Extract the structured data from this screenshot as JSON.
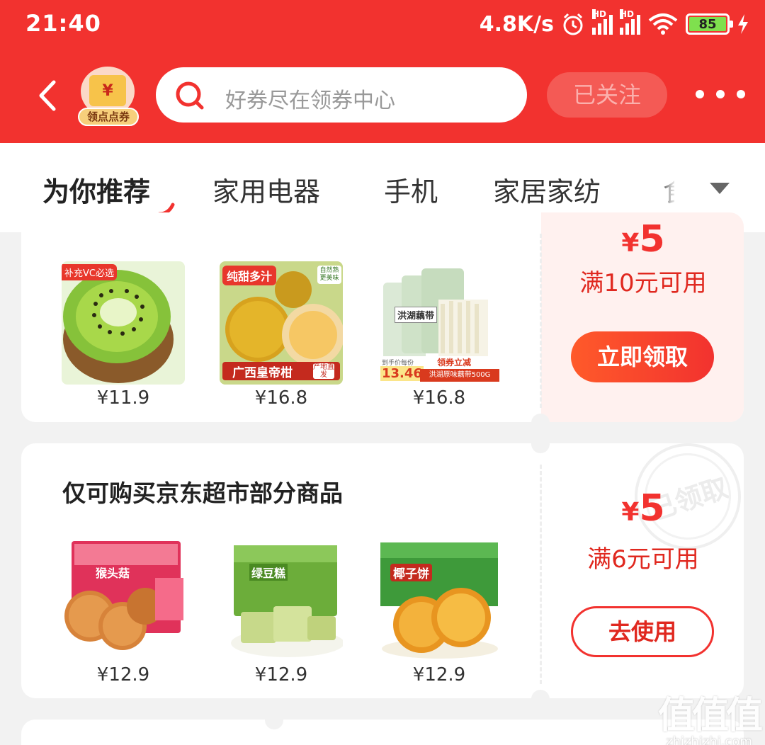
{
  "status": {
    "time": "21:40",
    "speed": "4.8K/s",
    "hd1": "HD",
    "hd2": "HD",
    "battery": "85"
  },
  "header": {
    "badge_symbol": "¥",
    "badge_label": "领点点券",
    "search_placeholder": "好券尽在领券中心",
    "follow_label": "已关注"
  },
  "tabs": [
    {
      "label": "为你推荐",
      "active": true
    },
    {
      "label": "家用电器"
    },
    {
      "label": "手机"
    },
    {
      "label": "家居家纺"
    },
    {
      "label": "食"
    }
  ],
  "coupons": [
    {
      "title": "",
      "symbol": "¥",
      "amount": "5",
      "condition": "满10元可用",
      "button": "立即领取",
      "products": [
        {
          "tag": "补充VC必选",
          "price": "¥11.9"
        },
        {
          "tag": "纯甜多汁",
          "tag2": "自然熟 更美味",
          "banner": "广西皇帝柑",
          "banner2": "产地直发",
          "price": "¥16.8"
        },
        {
          "brand": "洪湖藕带",
          "promo1": "到手价每份",
          "promo_price": "13.46",
          "promo2": "领券立减",
          "promo3": "洪湖原味藕带500G",
          "price": "¥16.8"
        }
      ]
    },
    {
      "title": "仅可购买京东超市部分商品",
      "symbol": "¥",
      "amount": "5",
      "condition": "满6元可用",
      "button": "去使用",
      "stamp": "已领取",
      "products": [
        {
          "label": "猴头菇",
          "price": "¥12.9"
        },
        {
          "label": "绿豆糕",
          "price": "¥12.9"
        },
        {
          "label": "椰子饼",
          "price": "¥12.9"
        }
      ]
    }
  ],
  "watermark": {
    "big": "值值值",
    "small": "zhizhizhi.com"
  }
}
